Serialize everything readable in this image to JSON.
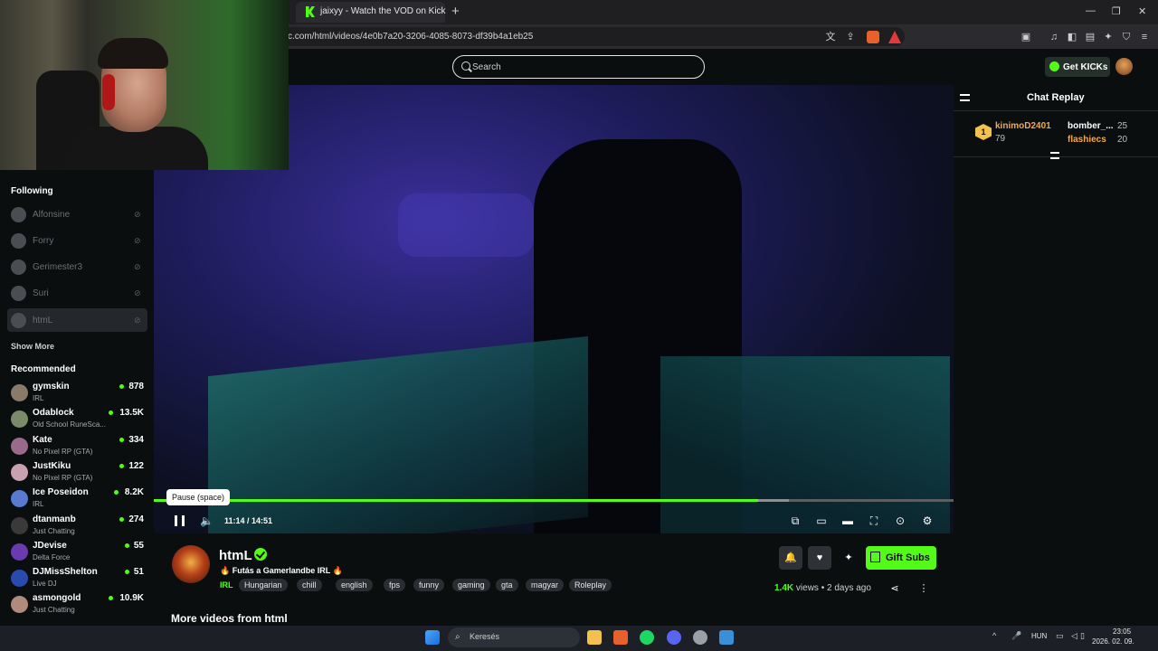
{
  "browser": {
    "tab_title": "jaixyy - Watch the VOD on Kick",
    "new_tab": "+",
    "url": "c.com/html/videos/4e0b7a20-3206-4085-8073-df39b4a1eb25",
    "window_min": "—",
    "window_max": "❐",
    "window_close": "✕"
  },
  "header": {
    "search_placeholder": "Search",
    "get_kicks": "Get KICKs"
  },
  "sidebar": {
    "following_title": "Following",
    "following": [
      {
        "name": "Alfonsine"
      },
      {
        "name": "Forry"
      },
      {
        "name": "Gerimester3"
      },
      {
        "name": "Suri"
      },
      {
        "name": "htmL"
      }
    ],
    "show_more": "Show More",
    "recommended_title": "Recommended",
    "recommended": [
      {
        "name": "gymskin",
        "category": "IRL",
        "viewers": "878",
        "color": "#8a7a6a"
      },
      {
        "name": "Odablock",
        "category": "Old School RuneSca...",
        "viewers": "13.5K",
        "color": "#7a8a6a"
      },
      {
        "name": "Kate",
        "category": "No Pixel RP (GTA)",
        "viewers": "334",
        "color": "#9a6a8a"
      },
      {
        "name": "JustKiku",
        "category": "No Pixel RP (GTA)",
        "viewers": "122",
        "color": "#c9a0b0"
      },
      {
        "name": "Ice Poseidon",
        "category": "IRL",
        "viewers": "8.2K",
        "color": "#5a7ad0"
      },
      {
        "name": "dtanmanb",
        "category": "Just Chatting",
        "viewers": "274",
        "color": "#3a3a3a"
      },
      {
        "name": "JDevise",
        "category": "Delta Force",
        "viewers": "55",
        "color": "#6a3ab0"
      },
      {
        "name": "DJMissShelton",
        "category": "Live DJ",
        "viewers": "51",
        "color": "#2a4ab0"
      },
      {
        "name": "asmongold",
        "category": "Just Chatting",
        "viewers": "10.9K",
        "color": "#b08a7a"
      }
    ]
  },
  "player": {
    "tooltip": "Pause (space)",
    "time": "11:14 / 14:51",
    "progress": 0.756,
    "buffered": 0.794
  },
  "stream": {
    "streamer": "htmL",
    "title": "🔥 Futás a Gamerlandbe IRL 🔥",
    "category": "IRL",
    "tags": [
      "Hungarian",
      "chill",
      "english",
      "fps",
      "funny",
      "gaming",
      "gta",
      "magyar",
      "Roleplay"
    ],
    "views_count": "1.4K",
    "views_label": "views",
    "separator": "•",
    "posted": "2 days ago",
    "gift_subs": "Gift Subs",
    "more_videos": "More videos from html"
  },
  "chat": {
    "title": "Chat Replay",
    "leaderboard_rank": "1",
    "leaderboard": [
      {
        "name": "kinimoD2401",
        "value": "79",
        "color": "#f2a94e"
      },
      {
        "name": "bomber_...",
        "value": "25",
        "color": "#ffffff"
      },
      {
        "name": "flashiecs",
        "value": "20",
        "color": "#f2a94e"
      }
    ]
  },
  "taskbar": {
    "search": "Keresés",
    "lang": "HUN",
    "time": "23:05",
    "date": "2026. 02. 09."
  }
}
